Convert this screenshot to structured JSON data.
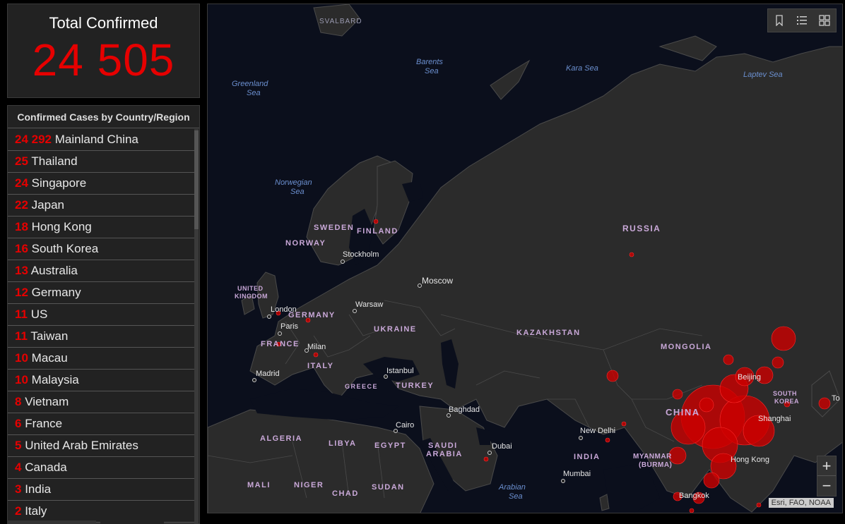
{
  "total": {
    "title": "Total Confirmed",
    "value": "24 505"
  },
  "list": {
    "header": "Confirmed Cases by Country/Region",
    "rows": [
      {
        "count": "24 292",
        "name": "Mainland China"
      },
      {
        "count": "25",
        "name": "Thailand"
      },
      {
        "count": "24",
        "name": "Singapore"
      },
      {
        "count": "22",
        "name": "Japan"
      },
      {
        "count": "18",
        "name": "Hong Kong"
      },
      {
        "count": "16",
        "name": "South Korea"
      },
      {
        "count": "13",
        "name": "Australia"
      },
      {
        "count": "12",
        "name": "Germany"
      },
      {
        "count": "11",
        "name": "US"
      },
      {
        "count": "11",
        "name": "Taiwan"
      },
      {
        "count": "10",
        "name": "Macau"
      },
      {
        "count": "10",
        "name": "Malaysia"
      },
      {
        "count": "8",
        "name": "Vietnam"
      },
      {
        "count": "6",
        "name": "France"
      },
      {
        "count": "5",
        "name": "United Arab Emirates"
      },
      {
        "count": "4",
        "name": "Canada"
      },
      {
        "count": "3",
        "name": "India"
      },
      {
        "count": "2",
        "name": "Italy"
      }
    ]
  },
  "map": {
    "seas": [
      "SVALBARD",
      "Barents",
      "Sea",
      "Kara Sea",
      "Laptev Sea",
      "Greenland",
      "Sea",
      "Norwegian",
      "Sea",
      "Arabian",
      "Sea"
    ],
    "countries": [
      "SWEDEN",
      "FINLAND",
      "NORWAY",
      "RUSSIA",
      "UNITED",
      "KINGDOM",
      "GERMANY",
      "UKRAINE",
      "KAZAKHSTAN",
      "MONGOLIA",
      "FRANCE",
      "ITALY",
      "GREECE",
      "TURKEY",
      "CHINA",
      "SOUTH",
      "KOREA",
      "ALGERIA",
      "LIBYA",
      "EGYPT",
      "SAUDI",
      "ARABIA",
      "INDIA",
      "MYANMAR",
      "(BURMA)",
      "MALI",
      "NIGER",
      "CHAD",
      "SUDAN"
    ],
    "cities": [
      "Stockholm",
      "Moscow",
      "London",
      "Warsaw",
      "Paris",
      "Milan",
      "Madrid",
      "Istanbul",
      "Baghdad",
      "Cairo",
      "Dubai",
      "New Delhi",
      "Mumbai",
      "Beijing",
      "Shanghai",
      "Hong Kong",
      "Bangkok",
      "To"
    ],
    "attribution": "Esri, FAO, NOAA",
    "zoom_in": "+",
    "zoom_out": "−"
  },
  "colors": {
    "accent": "#e60000",
    "panel": "#222222",
    "map_bg": "#0b0f1c",
    "land": "#2b2b2b"
  }
}
